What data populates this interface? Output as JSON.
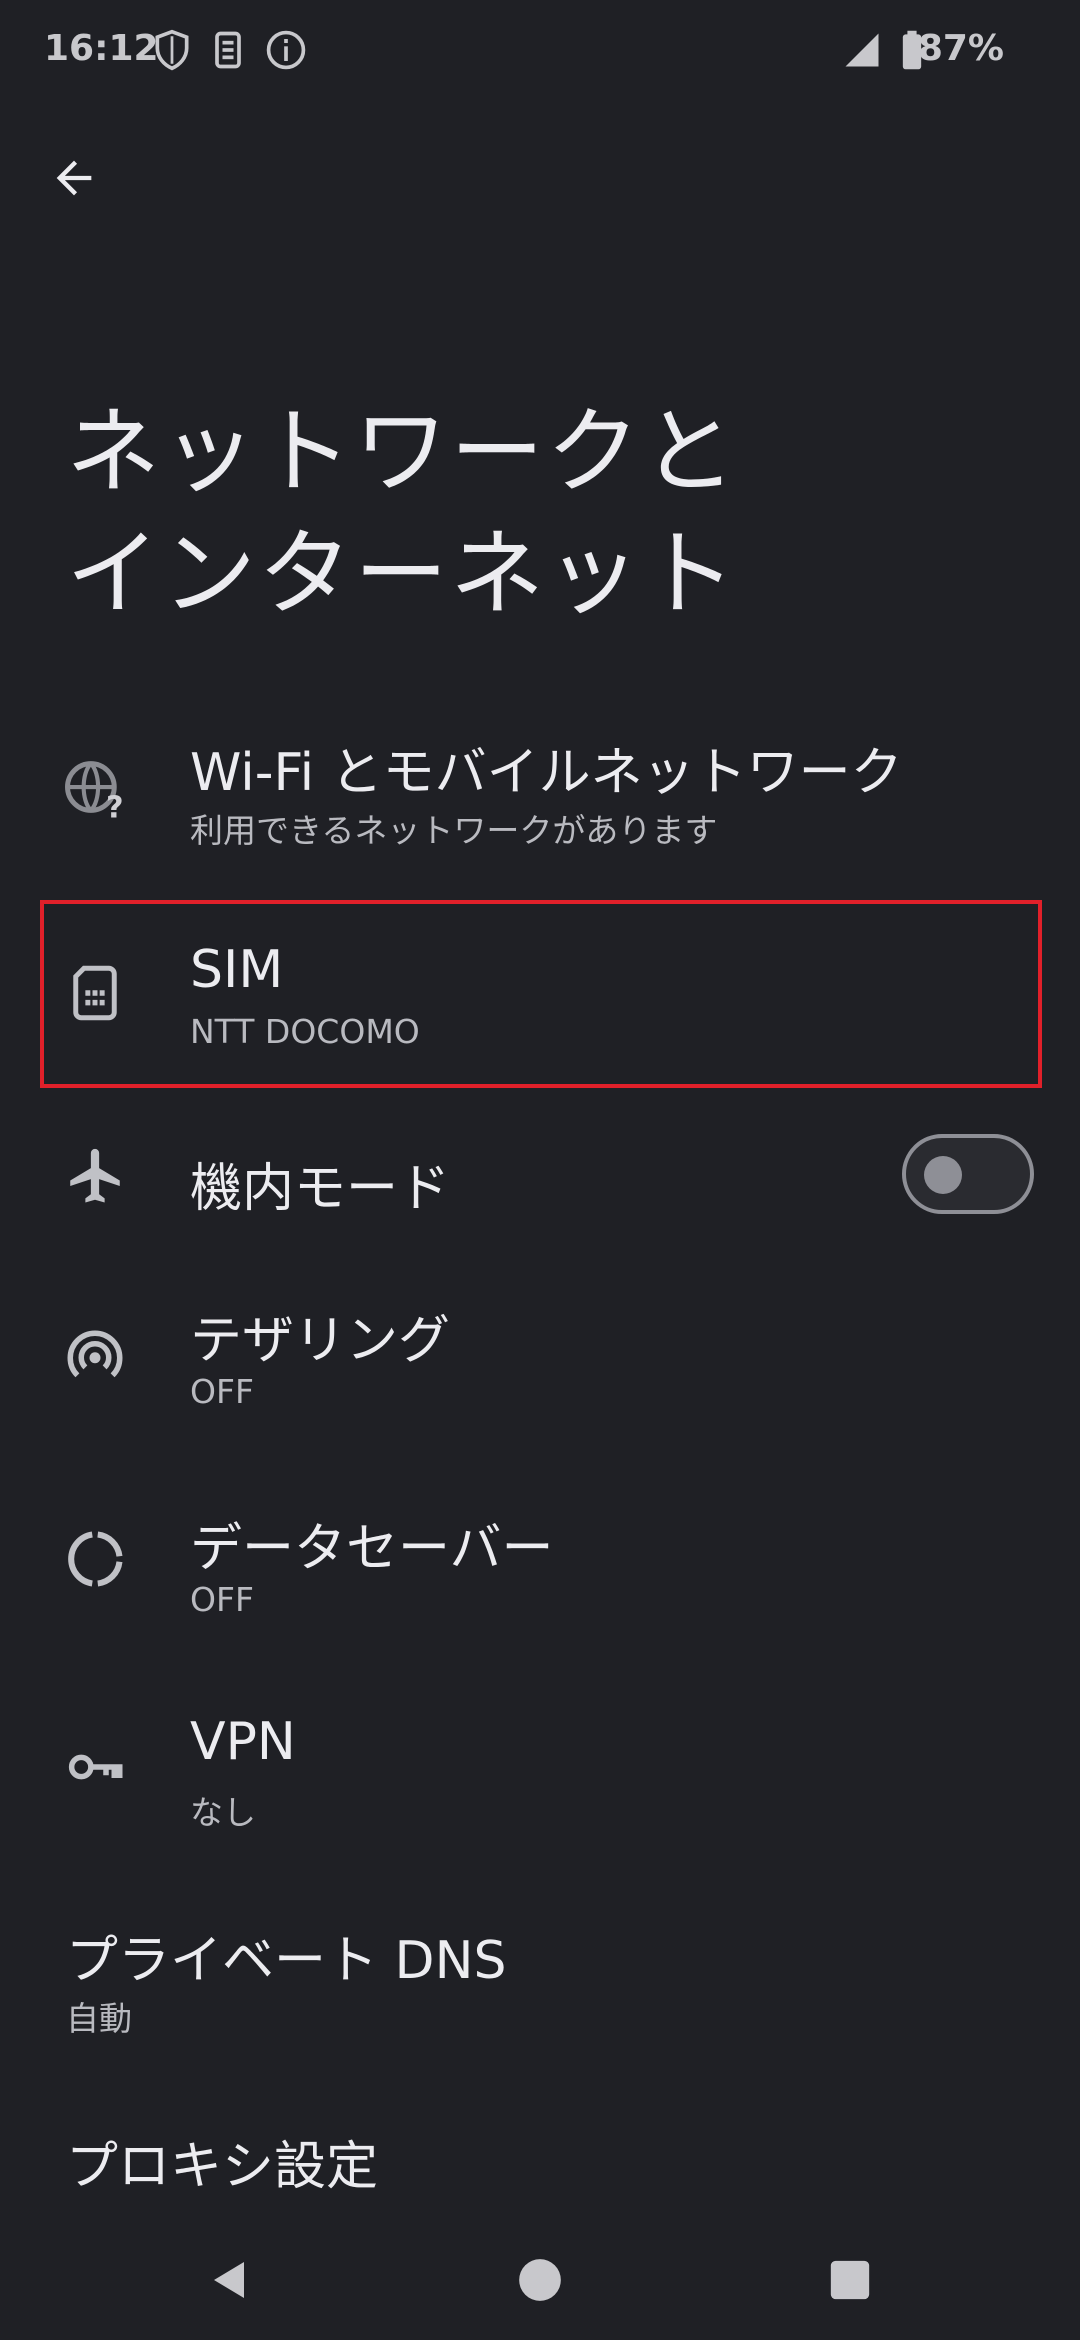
{
  "status_bar": {
    "time": "16:12",
    "battery": "87%",
    "icons": [
      "shield-icon",
      "sim-toolkit-icon",
      "info-icon",
      "signal-icon",
      "battery-icon"
    ]
  },
  "header": {
    "back_icon": "arrow-back-icon",
    "title_line1": "ネットワークと",
    "title_line2": "インターネット"
  },
  "items": [
    {
      "icon": "globe-question-icon",
      "title": "Wi-Fi とモバイルネットワーク",
      "subtitle": "利用できるネットワークがあります"
    },
    {
      "icon": "sim-card-icon",
      "title": "SIM",
      "subtitle": "NTT DOCOMO"
    },
    {
      "icon": "airplane-icon",
      "title": "機内モード",
      "toggle": false
    },
    {
      "icon": "hotspot-icon",
      "title": "テザリング",
      "subtitle": "OFF"
    },
    {
      "icon": "data-saver-icon",
      "title": "データセーバー",
      "subtitle": "OFF"
    },
    {
      "icon": "vpn-key-icon",
      "title": "VPN",
      "subtitle": "なし"
    },
    {
      "title": "プライベート DNS",
      "subtitle": "自動"
    },
    {
      "title": "プロキシ設定"
    }
  ],
  "colors": {
    "background": "#1f2025",
    "highlight": "#e0202a",
    "text": "#ececf0",
    "subtext": "#b9bac0"
  },
  "nav": {
    "back": "nav-back-icon",
    "home": "nav-home-icon",
    "recents": "nav-recents-icon"
  }
}
